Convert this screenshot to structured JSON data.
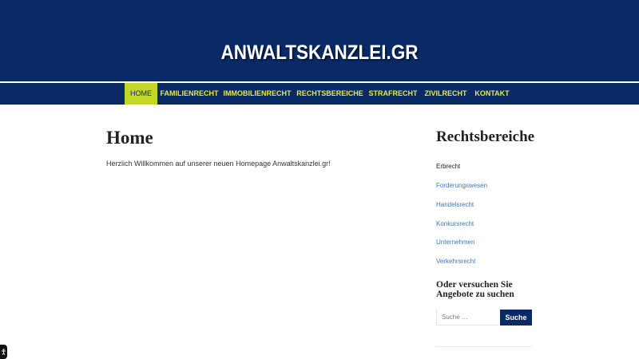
{
  "site": {
    "logo": "ANWALTSKANZLEI.GR"
  },
  "nav": {
    "items": [
      {
        "label": "HOME",
        "active": true
      },
      {
        "label": "FAMILIENRECHT",
        "active": false
      },
      {
        "label": "IMMOBILIENRECHT",
        "active": false
      },
      {
        "label": "RECHTSBEREICHE",
        "active": false
      },
      {
        "label": "STRAFRECHT",
        "active": false
      },
      {
        "label": "ZIVILRECHT",
        "active": false
      },
      {
        "label": "KONTAKT",
        "active": false
      }
    ]
  },
  "main": {
    "title": "Home",
    "text": "Herzlich Willkommen auf unserer neuen Homepage Anwaltskanzlei.gr!"
  },
  "sidebar": {
    "title": "Rechtsbereiche",
    "links": [
      {
        "label": "Erbrecht",
        "current": true
      },
      {
        "label": "Forderungswesen",
        "current": false
      },
      {
        "label": "Handelsrecht",
        "current": false
      },
      {
        "label": "Konkursrecht",
        "current": false
      },
      {
        "label": "Unternehmen",
        "current": false
      },
      {
        "label": "Verkehrsrecht",
        "current": false
      }
    ],
    "search": {
      "title": "Oder versuchen Sie Angebote zu suchen",
      "placeholder": "Suche …",
      "button_label": "Suche"
    }
  },
  "colors": {
    "header_bg": "#0a2a66",
    "nav_text": "#e7e94c",
    "nav_active_bg": "#c3d62a",
    "link": "#3a7ab8"
  },
  "icons": {
    "corner_badge": "accessibility-icon"
  }
}
